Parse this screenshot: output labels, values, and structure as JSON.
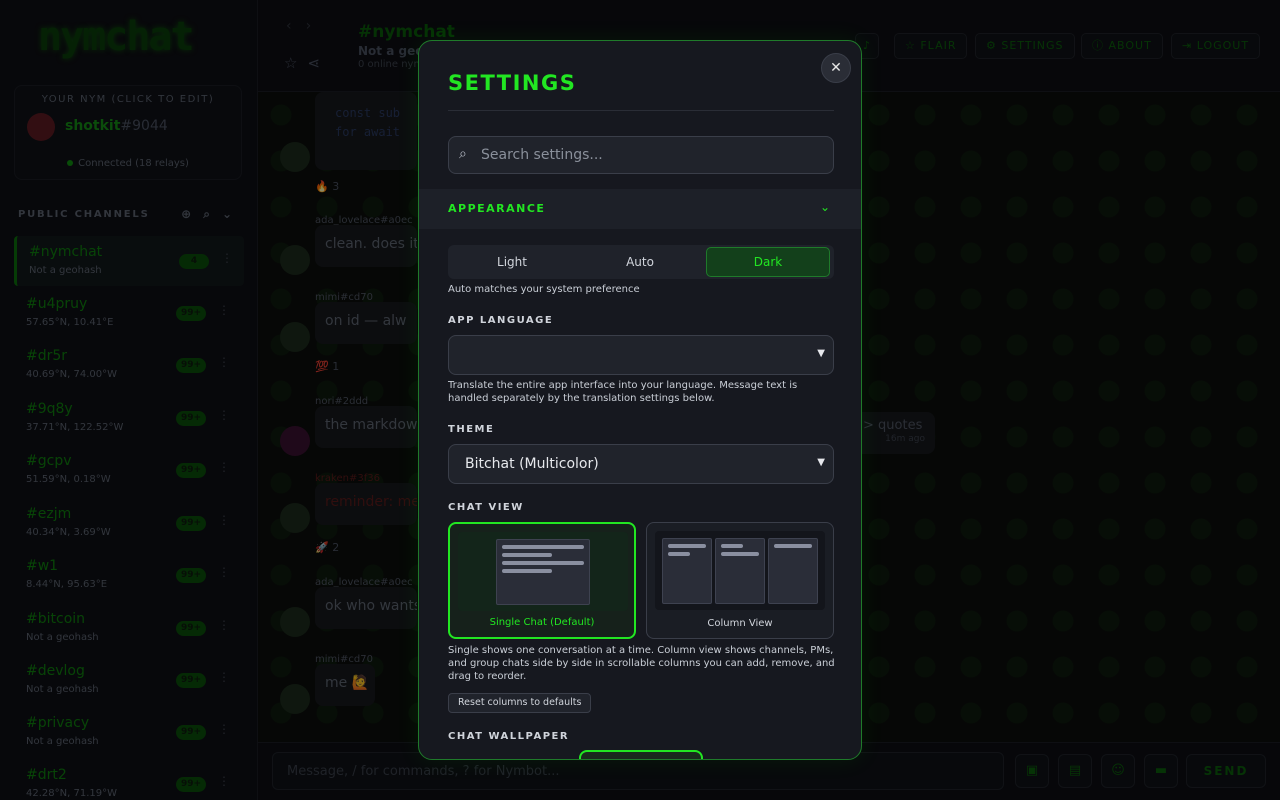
{
  "app": {
    "logo": "nymchat"
  },
  "sidebar": {
    "nym_caption": "YOUR NYM (CLICK TO EDIT)",
    "nick": "shotkit",
    "nick_tag": "#9044",
    "connection": "Connected (18 relays)",
    "channels_header": "PUBLIC CHANNELS",
    "channels": [
      {
        "name": "#nymchat",
        "sub": "Not a geohash",
        "badge": "4"
      },
      {
        "name": "#u4pruy",
        "sub": "57.65°N, 10.41°E",
        "badge": "99+"
      },
      {
        "name": "#dr5r",
        "sub": "40.69°N, 74.00°W",
        "badge": "99+"
      },
      {
        "name": "#9q8y",
        "sub": "37.71°N, 122.52°W",
        "badge": "99+"
      },
      {
        "name": "#gcpv",
        "sub": "51.59°N, 0.18°W",
        "badge": "99+"
      },
      {
        "name": "#ezjm",
        "sub": "40.34°N, 3.69°W",
        "badge": "99+"
      },
      {
        "name": "#w1",
        "sub": "8.44°N, 95.63°E",
        "badge": "99+"
      },
      {
        "name": "#bitcoin",
        "sub": "Not a geohash",
        "badge": "99+"
      },
      {
        "name": "#devlog",
        "sub": "Not a geohash",
        "badge": "99+"
      },
      {
        "name": "#privacy",
        "sub": "Not a geohash",
        "badge": "99+"
      },
      {
        "name": "#drt2",
        "sub": "42.28°N, 71.19°W",
        "badge": "99+"
      }
    ]
  },
  "topbar": {
    "channel_title": "#nymchat",
    "channel_sub": "Not a geoh",
    "online": "0 online nym",
    "buttons": {
      "flair": "FLAIR",
      "settings": "SETTINGS",
      "about": "ABOUT",
      "logout": "LOGOUT"
    }
  },
  "chat": {
    "code_line_1": "const sub",
    "code_line_2": "for await",
    "messages": [
      {
        "name": "ada_lovelace",
        "tag": "#a0ec",
        "text": "clean. does it"
      },
      {
        "name": "mimi",
        "tag": "#cd70",
        "text": "on  id  — alw"
      },
      {
        "name": "nori",
        "tag": "#2ddd",
        "text": "the markdown"
      },
      {
        "name": "kraken",
        "tag": "#3f36",
        "text": "reminder: me"
      },
      {
        "name": "ada_lovelace",
        "tag": "#a0ec",
        "text": "ok who wants"
      },
      {
        "name": "mimi",
        "tag": "#cd70",
        "text": "me 🙋"
      }
    ],
    "reactions": [
      "🔥 3",
      "💯 1",
      "🚀 2"
    ],
    "right_bubble": "> quotes",
    "right_time": "16m ago"
  },
  "composer": {
    "placeholder": "Message, / for commands, ? for Nymbot...",
    "send": "SEND"
  },
  "settings": {
    "title": "SETTINGS",
    "search_placeholder": "Search settings...",
    "section": "APPEARANCE",
    "modes": [
      "Light",
      "Auto",
      "Dark"
    ],
    "selected_mode": "Dark",
    "mode_hint": "Auto matches your system preference",
    "language_label": "APP LANGUAGE",
    "language_value": "",
    "language_hint": "Translate the entire app interface into your language. Message text is handled separately by the translation settings below.",
    "theme_label": "THEME",
    "theme_value": "Bitchat (Multicolor)",
    "chat_view_label": "CHAT VIEW",
    "view_single": "Single Chat (Default)",
    "view_column": "Column View",
    "view_hint": "Single shows one conversation at a time. Column view shows channels, PMs, and group chats side by side in scrollable columns you can add, remove, and drag to reorder.",
    "reset_columns": "Reset columns to defaults",
    "wallpaper_label": "CHAT WALLPAPER"
  },
  "colors": {
    "accent": "#22e622",
    "modal_bg": "#16181f",
    "app_bg": "#0b0c10"
  }
}
